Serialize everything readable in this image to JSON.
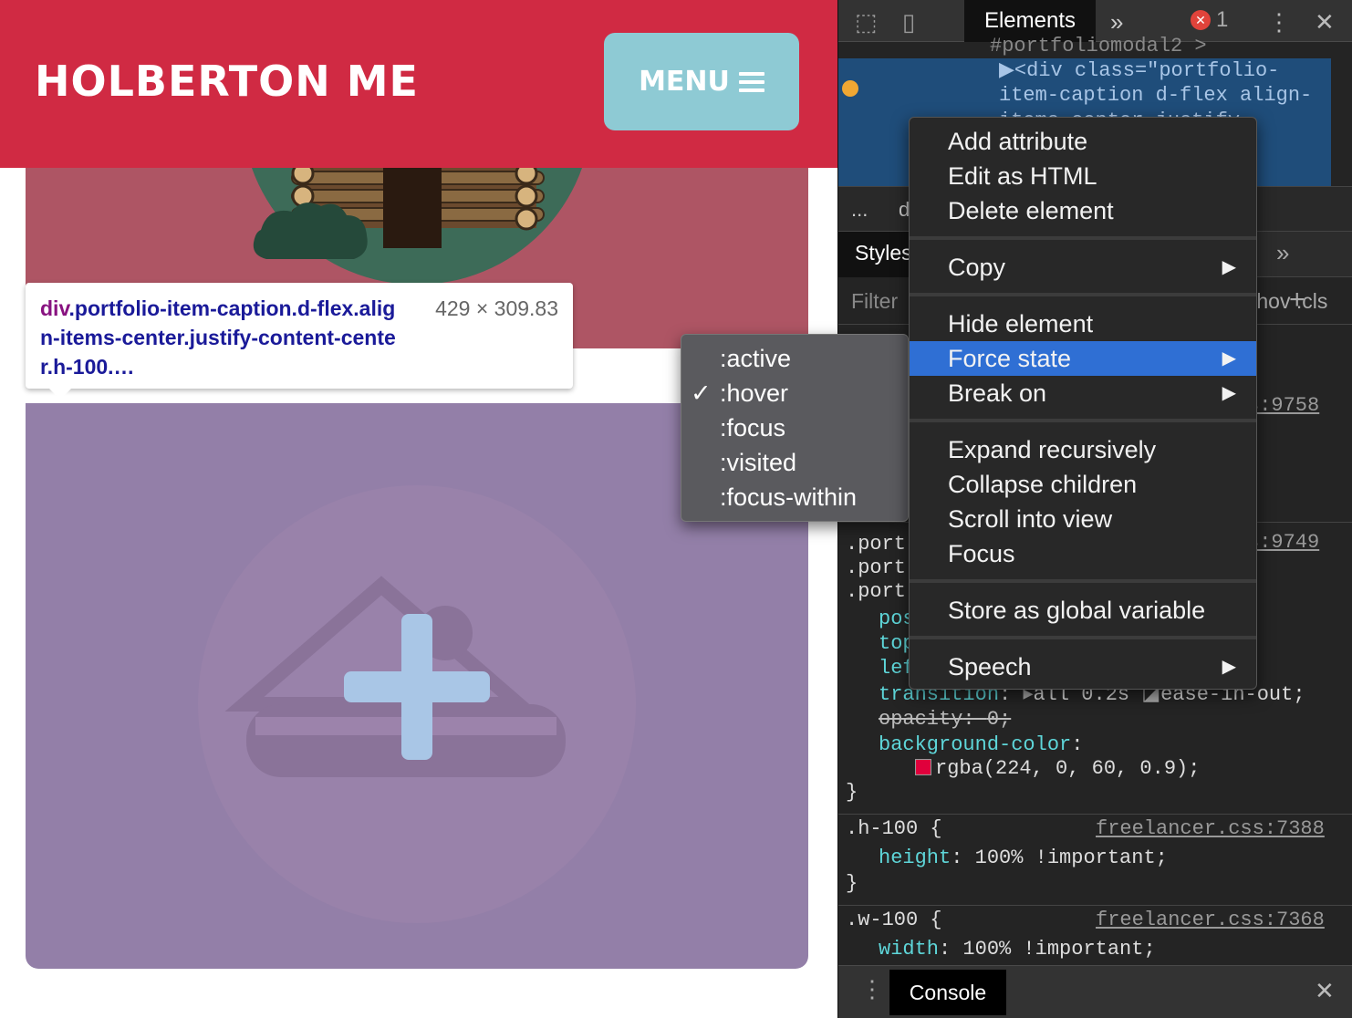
{
  "page": {
    "brand": "HOLBERTON ME",
    "menu_label": "MENU"
  },
  "tooltip": {
    "tag": "div",
    "selector": ".portfolio-item-caption.d-flex.align-items-center.justify-content-center.h-100.…",
    "size": "429 × 309.83"
  },
  "devtools": {
    "tabs": {
      "active": "Elements",
      "more": "»"
    },
    "errors": "1",
    "dom_lines": [
      "#portfoliomodal2 >",
      "▶<div class=\"portfolio-",
      "item-caption d-flex align-",
      "items-center justify-"
    ],
    "crumbs": [
      "...",
      "d"
    ],
    "styles_tab": "Styles",
    "filter_placeholder": "Filter",
    "hov_cls": ":hov .cls",
    "rules": {
      "r1_link": "s:9758",
      "r2_link": "s:9749",
      "r2_selectors": [
        ".port",
        ".port",
        ".port"
      ],
      "r2_props": [
        "pos",
        "top",
        "lef"
      ],
      "transition": {
        "prop": "transition",
        "value": "all 0.2s",
        "easing": "ease-in-out;"
      },
      "opacity": {
        "prop": "opacity",
        "value": "0;"
      },
      "bg": {
        "prop": "background-color",
        "value": "rgba(224, 0, 60, 0.9);",
        "swatch": "#e0003c"
      },
      "h100": {
        "selector": ".h-100 {",
        "link": "freelancer.css:7388",
        "prop": "height",
        "value": "100% !important;"
      },
      "w100": {
        "selector": ".w-100 {",
        "link": "freelancer.css:7368",
        "prop": "width",
        "value": "100% !important;"
      },
      "close_brace": "}"
    },
    "console_tab": "Console"
  },
  "context_menu": {
    "items": [
      {
        "label": "Add attribute"
      },
      {
        "label": "Edit as HTML"
      },
      {
        "label": "Delete element"
      },
      {
        "label": "Copy"
      },
      {
        "label": "Hide element"
      },
      {
        "label": "Force state"
      },
      {
        "label": "Break on"
      },
      {
        "label": "Expand recursively"
      },
      {
        "label": "Collapse children"
      },
      {
        "label": "Scroll into view"
      },
      {
        "label": "Focus"
      },
      {
        "label": "Store as global variable"
      },
      {
        "label": "Speech"
      }
    ],
    "highlighted": "Force state",
    "submenu_arrow": "▶"
  },
  "force_state_menu": {
    "items": [
      ":active",
      ":hover",
      ":focus",
      ":visited",
      ":focus-within"
    ],
    "checked": ":hover",
    "check_mark": "✓"
  },
  "colors": {
    "navbar": "#d02a43",
    "menu_button": "#8ecad4",
    "item1_overlay": "#ae5564",
    "item2_overlay": "#937fa8",
    "plus_icon": "#a9c6e6",
    "menu_highlight": "#2f6fd4"
  }
}
